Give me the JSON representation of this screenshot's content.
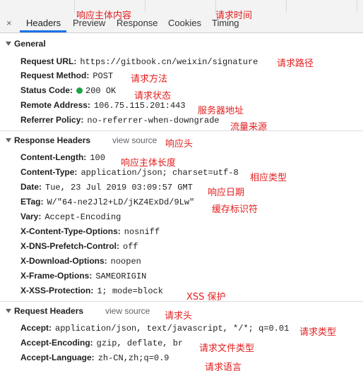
{
  "tabs": {
    "close": "×",
    "items": [
      "Headers",
      "Preview",
      "Response",
      "Cookies",
      "Timing"
    ]
  },
  "general": {
    "title": "General",
    "rows": [
      {
        "key": "Request URL:",
        "value": "https://gitbook.cn/weixin/signature"
      },
      {
        "key": "Request Method:",
        "value": "POST"
      },
      {
        "key": "Status Code:",
        "value": "200 OK"
      },
      {
        "key": "Remote Address:",
        "value": "106.75.115.201:443"
      },
      {
        "key": "Referrer Policy:",
        "value": "no-referrer-when-downgrade"
      }
    ]
  },
  "response_headers": {
    "title": "Response Headers",
    "view_source": "view source",
    "rows": [
      {
        "key": "Content-Length:",
        "value": "100"
      },
      {
        "key": "Content-Type:",
        "value": "application/json; charset=utf-8"
      },
      {
        "key": "Date:",
        "value": "Tue, 23 Jul 2019 03:09:57 GMT"
      },
      {
        "key": "ETag:",
        "value": "W/\"64-ne2Jl2+LD/jKZ4ExDd/9Lw\""
      },
      {
        "key": "Vary:",
        "value": "Accept-Encoding"
      },
      {
        "key": "X-Content-Type-Options:",
        "value": "nosniff"
      },
      {
        "key": "X-DNS-Prefetch-Control:",
        "value": "off"
      },
      {
        "key": "X-Download-Options:",
        "value": "noopen"
      },
      {
        "key": "X-Frame-Options:",
        "value": "SAMEORIGIN"
      },
      {
        "key": "X-XSS-Protection:",
        "value": "1; mode=block"
      }
    ]
  },
  "request_headers": {
    "title": "Request Headers",
    "view_source": "view source",
    "rows": [
      {
        "key": "Accept:",
        "value": "application/json, text/javascript, */*; q=0.01"
      },
      {
        "key": "Accept-Encoding:",
        "value": "gzip, deflate, br"
      },
      {
        "key": "Accept-Language:",
        "value": "zh-CN,zh;q=0.9"
      }
    ]
  },
  "annotations": {
    "response_body": "响应主体内容",
    "request_time": "请求时间",
    "request_path": "请求路径",
    "request_method": "请求方法",
    "request_status": "请求状态",
    "server_address": "服务器地址",
    "traffic_source": "流量来源",
    "response_header": "响应头",
    "body_length": "响应主体长度",
    "content_type": "相应类型",
    "response_date": "响应日期",
    "cache_id": "缓存标识符",
    "xss": "XSS 保护",
    "request_header": "请求头",
    "accept_type": "请求类型",
    "accept_file_type": "请求文件类型",
    "accept_language": "请求语言"
  },
  "colors": {
    "annotation": "#e31e1e",
    "active_tab_underline": "#1a73e8",
    "status_dot": "#1ea446"
  }
}
